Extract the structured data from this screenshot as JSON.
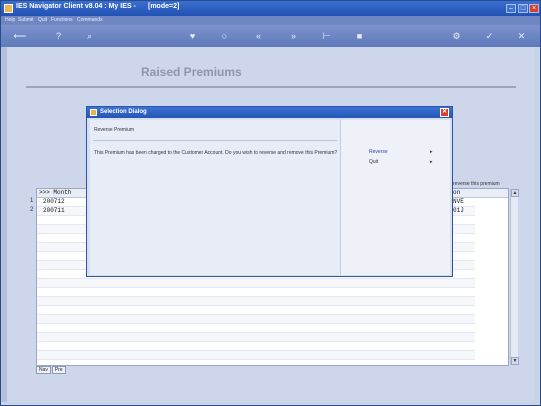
{
  "window": {
    "title": "IES Navigator Client v8.04 : My IES -",
    "mode": "[mode=2]"
  },
  "menu": {
    "items": [
      "Help",
      "Submit",
      "Quit",
      "Functions",
      "Commands"
    ]
  },
  "page": {
    "title": "Raised Premiums"
  },
  "grid": {
    "column_header": ">>> Month",
    "row_numbers": [
      "1",
      "2"
    ],
    "months": [
      "200712",
      "200711"
    ],
    "right_header_fragment": "reverse this premium",
    "right_col_header": "on",
    "right_values": [
      "NVE",
      "01J"
    ]
  },
  "tabs": [
    "Nav",
    "Pre"
  ],
  "dialog": {
    "title": "Selection Dialog",
    "heading": "Reverse Premium",
    "message": "This Premium has been charged to the Customer Account. Do you wish to reverse and remove this Premium?",
    "options": [
      {
        "label": "Reverse",
        "color": "#2a3fb8"
      },
      {
        "label": "Quit",
        "color": "#333333"
      }
    ]
  }
}
